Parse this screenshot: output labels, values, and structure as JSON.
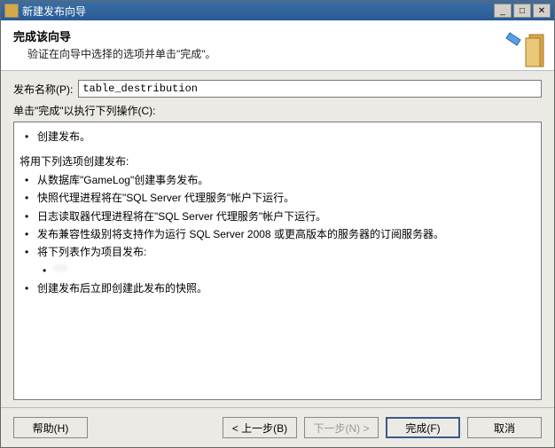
{
  "window": {
    "title": "新建发布向导"
  },
  "header": {
    "title": "完成该向导",
    "subtitle": "验证在向导中选择的选项并单击\"完成\"。"
  },
  "form": {
    "name_label": "发布名称(P):",
    "name_value": "table_destribution",
    "actions_label": "单击\"完成\"以执行下列操作(C):"
  },
  "summary": {
    "line1": "创建发布。",
    "heading2": "将用下列选项创建发布:",
    "items": [
      "从数据库\"GameLog\"创建事务发布。",
      "快照代理进程将在\"SQL Server 代理服务\"帐户下运行。",
      "日志读取器代理进程将在\"SQL Server 代理服务\"帐户下运行。",
      "发布兼容性级别将支持作为运行 SQL Server 2008 或更高版本的服务器的订阅服务器。",
      "将下列表作为项目发布:"
    ],
    "nested_item": "\"                        \"",
    "final": "创建发布后立即创建此发布的快照。"
  },
  "buttons": {
    "help": "帮助(H)",
    "back": "< 上一步(B)",
    "next": "下一步(N) >",
    "finish": "完成(F)",
    "cancel": "取消"
  }
}
